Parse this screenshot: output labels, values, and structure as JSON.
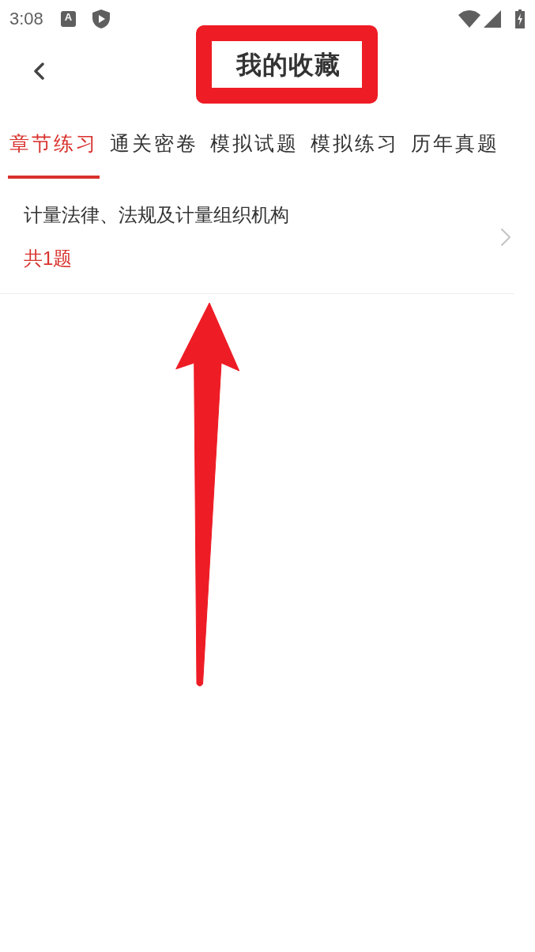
{
  "status_bar": {
    "time": "3:08",
    "notifications": [
      {
        "kind": "letter",
        "glyph": "A"
      },
      {
        "kind": "shield"
      }
    ]
  },
  "header": {
    "title": "我的收藏",
    "highlighted": true
  },
  "tabs": [
    {
      "label": "章节练习",
      "selected": true
    },
    {
      "label": "通关密卷",
      "selected": false
    },
    {
      "label": "模拟试题",
      "selected": false
    },
    {
      "label": "模拟练习",
      "selected": false
    },
    {
      "label": "历年真题",
      "selected": false
    }
  ],
  "items": [
    {
      "title": "计量法律、法规及计量组织机构",
      "count": "共1题"
    }
  ]
}
